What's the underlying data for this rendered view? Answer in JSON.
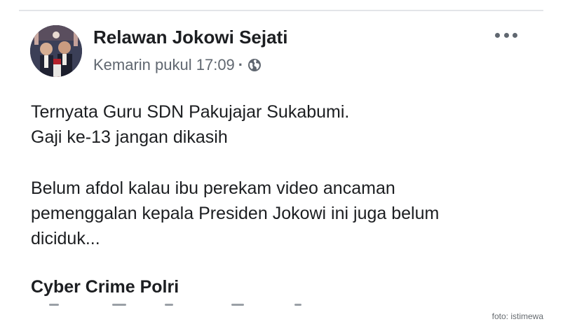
{
  "post": {
    "author": "Relawan Jokowi Sejati",
    "timestamp": "Kemarin pukul 17:09",
    "separator": "·",
    "audience_icon": "globe-icon",
    "more_icon": "more-options-icon",
    "body": {
      "line1": "Ternyata Guru SDN Pakujajar Sukabumi.",
      "line2": "Gaji ke-13 jangan dikasih",
      "line3": "Belum afdol kalau ibu perekam video ancaman",
      "line4": "pemenggalan kepala Presiden Jokowi ini juga belum",
      "line5": "diciduk..."
    },
    "footer_bold": "Cyber Crime Polri"
  },
  "photo_credit": "foto: istimewa",
  "colors": {
    "text": "#1c1e21",
    "meta": "#606770",
    "divider": "#e3e5e8",
    "background": "#ffffff"
  }
}
